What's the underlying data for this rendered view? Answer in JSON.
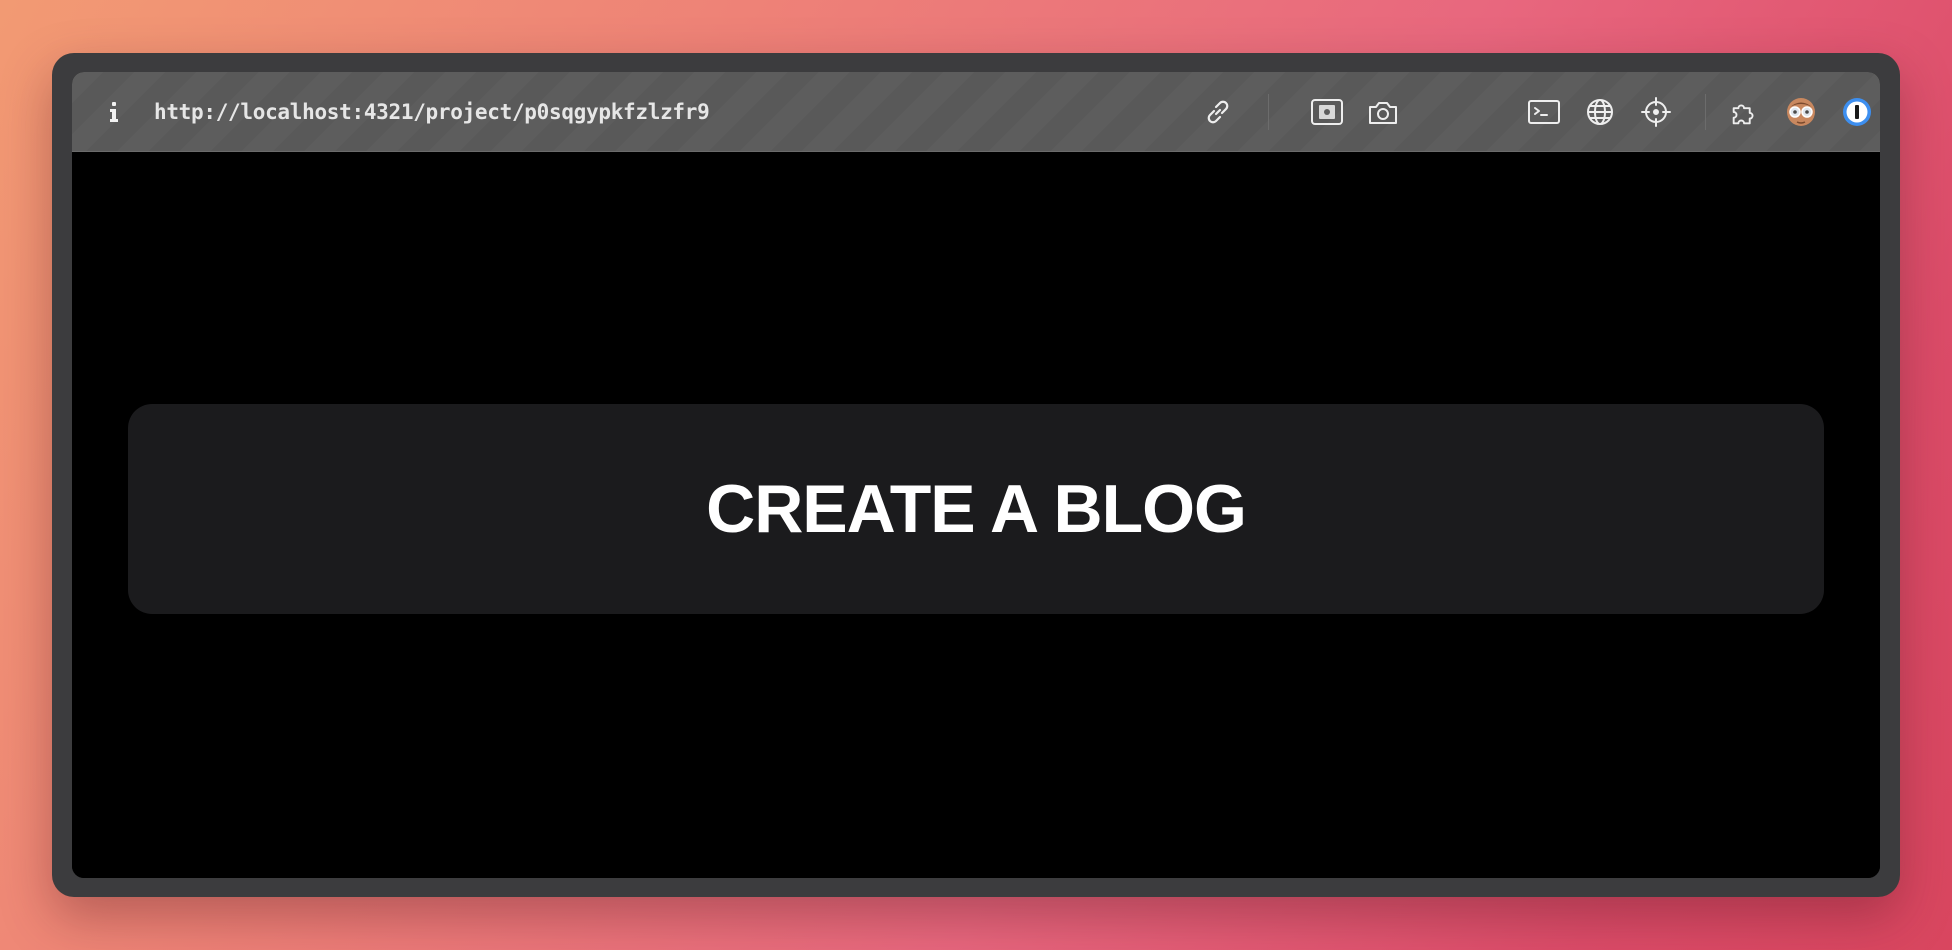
{
  "browser": {
    "url": "http://localhost:4321/project/p0sqgypkfzlzfr9",
    "info_icon": "info-icon",
    "toolbar_icons": [
      "link-icon",
      "image-icon",
      "camera-icon",
      "terminal-icon",
      "globe-icon",
      "crosshair-icon",
      "extensions-icon",
      "avatar-glasses-icon",
      "password-manager-icon",
      "sidebar-toggle-icon"
    ]
  },
  "page": {
    "cta_label": "CREATE A BLOG"
  },
  "colors": {
    "content_background": "#000000",
    "card_background": "#1b1b1d",
    "cta_text": "#ffffff",
    "toolbar_background": "#5d5d5d",
    "accent_blue": "#3d8ff0"
  }
}
